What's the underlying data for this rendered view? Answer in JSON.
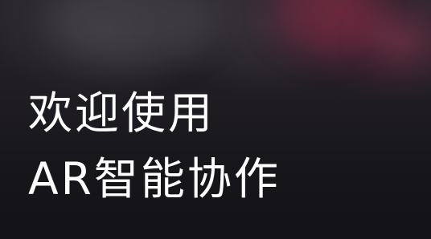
{
  "welcome": {
    "line1": "欢迎使用",
    "line2": "AR智能协作"
  },
  "colors": {
    "background": "#17161b",
    "text": "#ffffff",
    "accent_glow": "#8c2846"
  }
}
